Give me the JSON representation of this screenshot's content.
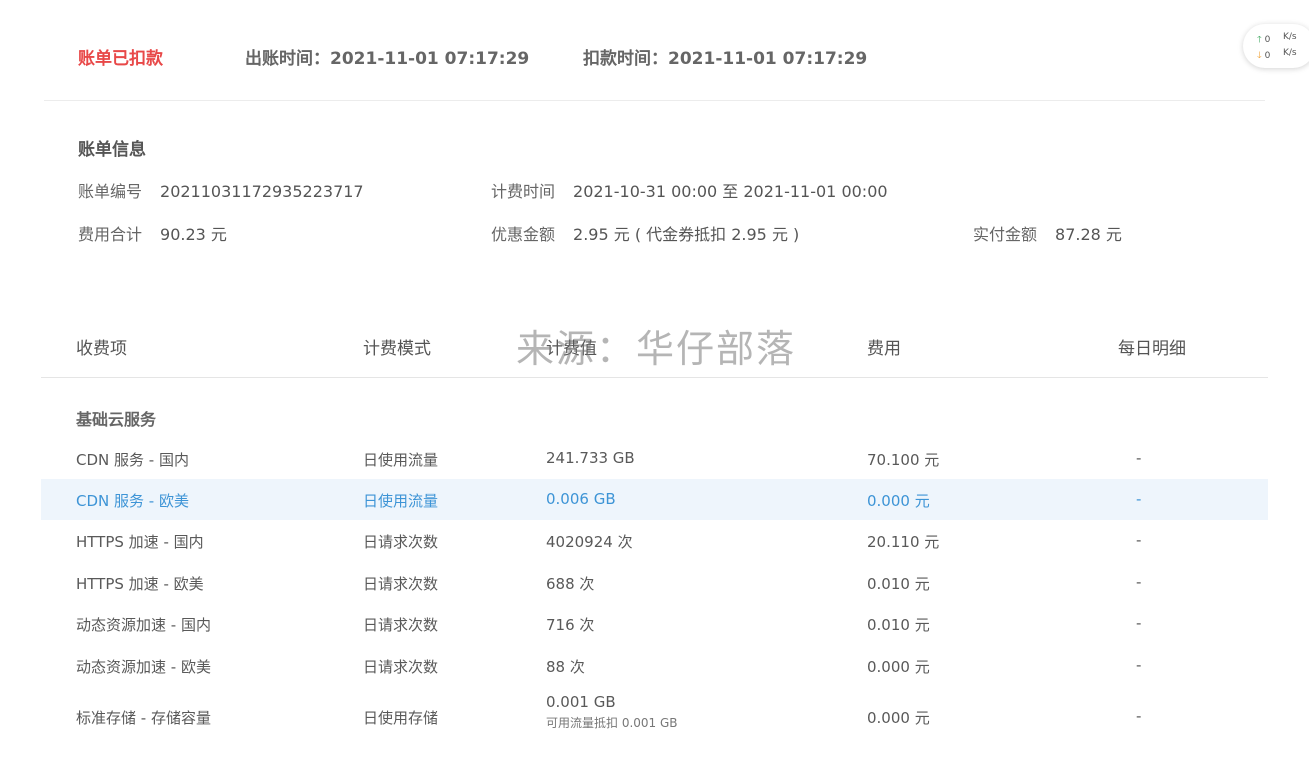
{
  "header": {
    "status": "账单已扣款",
    "bill_time_label": "出账时间：",
    "bill_time": "2021-11-01 07:17:29",
    "deduct_time_label": "扣款时间：",
    "deduct_time": "2021-11-01 07:17:29"
  },
  "speed": {
    "up_arrow": "🡑",
    "up_value": "0",
    "down_arrow": "🡓",
    "down_value": "0",
    "unit": "K/s"
  },
  "info": {
    "title": "账单信息",
    "bill_no_label": "账单编号",
    "bill_no": "20211031172935223717",
    "period_label": "计费时间",
    "period": "2021-10-31 00:00 至 2021-11-01 00:00",
    "total_label": "费用合计",
    "total": "90.23 元",
    "discount_label": "优惠金额",
    "discount": "2.95 元 ( 代金券抵扣 2.95 元 )",
    "paid_label": "实付金额",
    "paid": "87.28 元"
  },
  "watermark": "来源：华仔部落",
  "table": {
    "headers": [
      "收费项",
      "计费模式",
      "计费值",
      "费用",
      "每日明细"
    ],
    "group_title": "基础云服务",
    "rows": [
      {
        "item": "CDN 服务 - 国内",
        "mode": "日使用流量",
        "value": "241.733 GB",
        "fee": "70.100 元",
        "detail": "-"
      },
      {
        "item": "CDN 服务 - 欧美",
        "mode": "日使用流量",
        "value": "0.006 GB",
        "fee": "0.000 元",
        "detail": "-"
      },
      {
        "item": "HTTPS 加速 - 国内",
        "mode": "日请求次数",
        "value": "4020924 次",
        "fee": "20.110 元",
        "detail": "-"
      },
      {
        "item": "HTTPS 加速 - 欧美",
        "mode": "日请求次数",
        "value": "688 次",
        "fee": "0.010 元",
        "detail": "-"
      },
      {
        "item": "动态资源加速 - 国内",
        "mode": "日请求次数",
        "value": "716 次",
        "fee": "0.010 元",
        "detail": "-"
      },
      {
        "item": "动态资源加速 - 欧美",
        "mode": "日请求次数",
        "value": "88 次",
        "fee": "0.000 元",
        "detail": "-"
      },
      {
        "item": "标准存储 - 存储容量",
        "mode": "日使用存储",
        "value": "0.001 GB",
        "value_note": "可用流量抵扣 0.001 GB",
        "fee": "0.000 元",
        "detail": "-"
      }
    ]
  }
}
